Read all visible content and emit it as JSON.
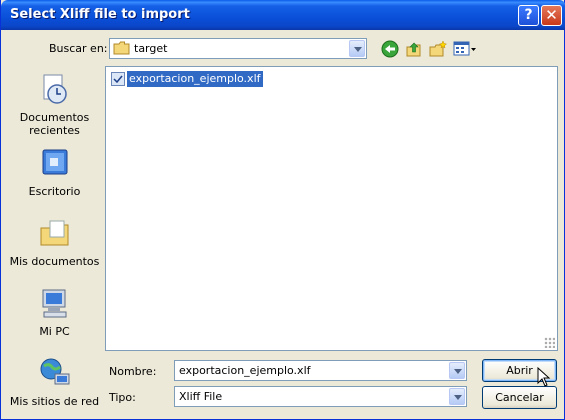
{
  "window": {
    "title": "Select Xliff file to import",
    "help_label": "?",
    "close_label": "✕"
  },
  "lookin": {
    "label": "Buscar en:",
    "value": "target"
  },
  "toolbar": {
    "icons": [
      "back-icon",
      "up-folder-icon",
      "new-folder-icon",
      "view-menu-icon"
    ]
  },
  "places": [
    {
      "label": "Documentos recientes",
      "icon": "recent-documents-icon"
    },
    {
      "label": "Escritorio",
      "icon": "desktop-icon"
    },
    {
      "label": "Mis documentos",
      "icon": "my-documents-icon"
    },
    {
      "label": "Mi PC",
      "icon": "my-computer-icon"
    },
    {
      "label": "Mis sitios de red",
      "icon": "network-places-icon"
    }
  ],
  "files": [
    {
      "name": "exportacion_ejemplo.xlf",
      "selected": true
    }
  ],
  "filename": {
    "label": "Nombre:",
    "value": "exportacion_ejemplo.xlf"
  },
  "filetype": {
    "label": "Tipo:",
    "value": "Xliff File"
  },
  "buttons": {
    "open": "Abrir",
    "cancel": "Cancelar"
  },
  "colors": {
    "titlebar": "#0a4fd8",
    "selection": "#316ac5",
    "dialog_bg": "#ece9d8"
  }
}
